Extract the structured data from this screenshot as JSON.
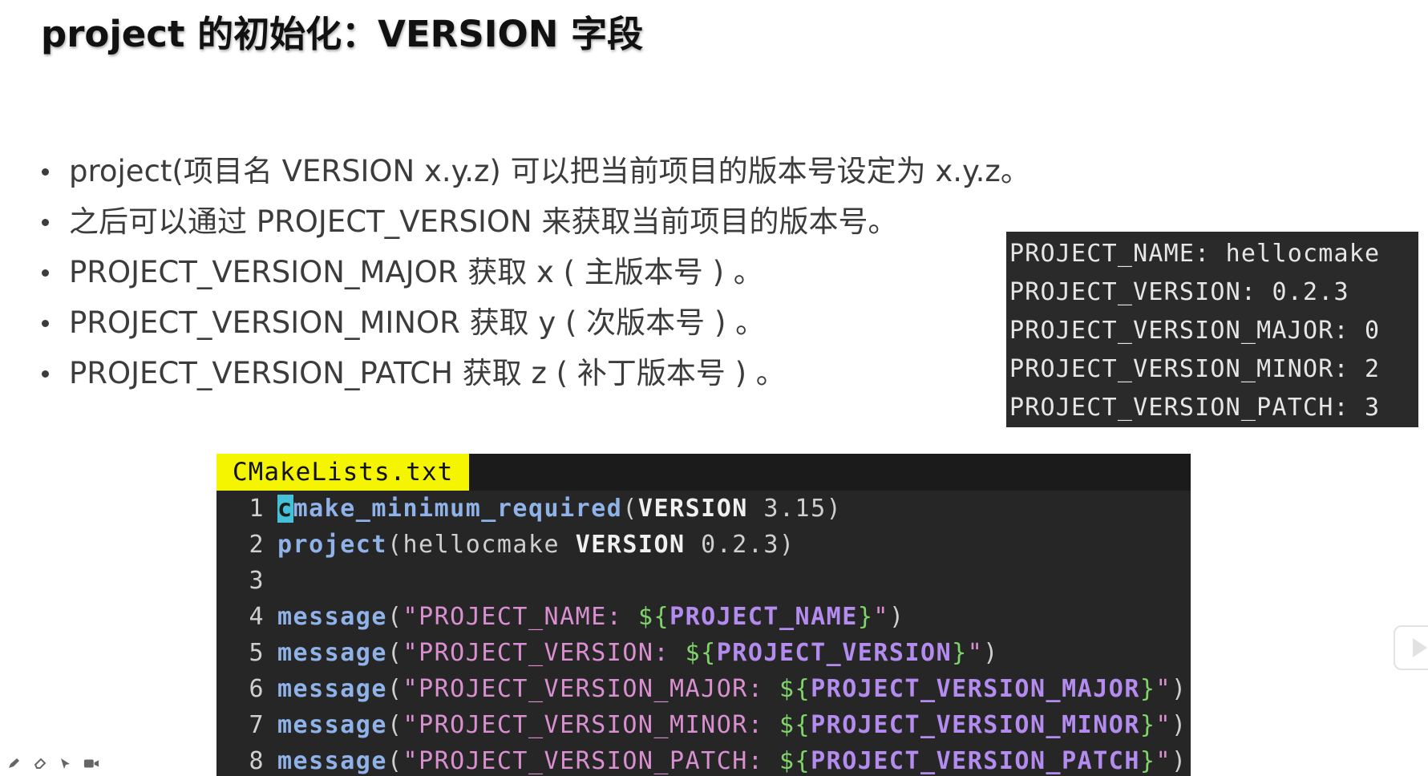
{
  "slide": {
    "title": "project 的初始化：VERSION 字段"
  },
  "bullets": [
    {
      "text": "project(项目名 VERSION x.y.z) 可以把当前项目的版本号设定为 x.y.z。"
    },
    {
      "text": "之后可以通过 PROJECT_VERSION 来获取当前项目的版本号。"
    },
    {
      "text": "PROJECT_VERSION_MAJOR 获取 x ( 主版本号 ) 。"
    },
    {
      "text": "PROJECT_VERSION_MINOR 获取 y ( 次版本号 ) 。"
    },
    {
      "text": "PROJECT_VERSION_PATCH 获取 z ( 补丁版本号 ) 。"
    }
  ],
  "output": {
    "lines": [
      "PROJECT_NAME: hellocmake",
      "PROJECT_VERSION: 0.2.3",
      "PROJECT_VERSION_MAJOR: 0",
      "PROJECT_VERSION_MINOR: 2",
      "PROJECT_VERSION_PATCH: 3"
    ]
  },
  "editor": {
    "tab_label": "CMakeLists.txt",
    "lines": [
      {
        "num": "1",
        "cursor_char": "c",
        "fn": "make_minimum_required",
        "open": "(",
        "kw": "VERSION",
        "rest": " 3.15",
        "close": ")"
      },
      {
        "num": "2",
        "fn": "project",
        "open": "(",
        "arg": "hellocmake ",
        "kw": "VERSION",
        "rest": " 0.2.3",
        "close": ")"
      },
      {
        "num": "3"
      },
      {
        "num": "4",
        "fn": "message",
        "open": "(",
        "q1": "\"",
        "str": "PROJECT_NAME: ",
        "dl": "${",
        "var": "PROJECT_NAME",
        "dr": "}",
        "q2": "\"",
        "close": ")"
      },
      {
        "num": "5",
        "fn": "message",
        "open": "(",
        "q1": "\"",
        "str": "PROJECT_VERSION: ",
        "dl": "${",
        "var": "PROJECT_VERSION",
        "dr": "}",
        "q2": "\"",
        "close": ")"
      },
      {
        "num": "6",
        "fn": "message",
        "open": "(",
        "q1": "\"",
        "str": "PROJECT_VERSION_MAJOR: ",
        "dl": "${",
        "var": "PROJECT_VERSION_MAJOR",
        "dr": "}",
        "q2": "\"",
        "close": ")"
      },
      {
        "num": "7",
        "fn": "message",
        "open": "(",
        "q1": "\"",
        "str": "PROJECT_VERSION_MINOR: ",
        "dl": "${",
        "var": "PROJECT_VERSION_MINOR",
        "dr": "}",
        "q2": "\"",
        "close": ")"
      },
      {
        "num": "8",
        "fn": "message",
        "open": "(",
        "q1": "\"",
        "str": "PROJECT_VERSION_PATCH: ",
        "dl": "${",
        "var": "PROJECT_VERSION_PATCH",
        "dr": "}",
        "q2": "\"",
        "close": ")"
      }
    ]
  },
  "toolbar": {
    "icons": [
      "pen-icon",
      "eraser-icon",
      "pointer-icon",
      "camera-icon"
    ]
  },
  "colors": {
    "tab_accent": "#f5f500",
    "editor_bg": "#262626",
    "function": "#8fb2e8",
    "string": "#d98fd0",
    "variable": "#b48cf0",
    "interpolation": "#7fd46a"
  }
}
